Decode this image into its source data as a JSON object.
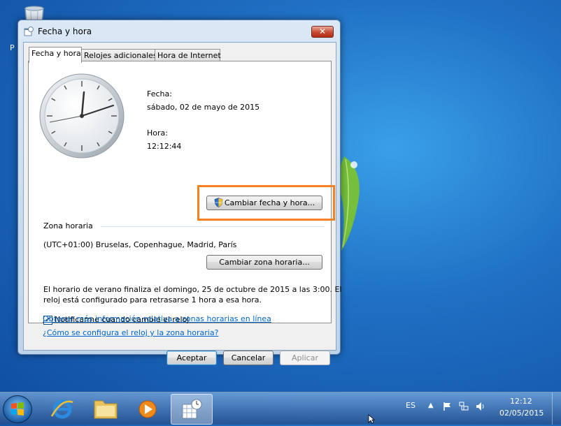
{
  "window": {
    "title": "Fecha y hora",
    "close_label": "✕"
  },
  "tabs": [
    {
      "label": "Fecha y hora",
      "active": true
    },
    {
      "label": "Relojes adicionales",
      "active": false
    },
    {
      "label": "Hora de Internet",
      "active": false
    }
  ],
  "date": {
    "label": "Fecha:",
    "value": "sábado, 02 de mayo de 2015"
  },
  "time": {
    "label": "Hora:",
    "value": "12:12:44"
  },
  "change_datetime_button": "Cambiar fecha y hora...",
  "timezone": {
    "section_label": "Zona horaria",
    "value": "(UTC+01:00) Bruselas, Copenhague, Madrid, París",
    "change_button": "Cambiar zona horaria..."
  },
  "dst_notice": {
    "line1": "El horario de verano finaliza el domingo, 25 de octubre de 2015 a las 3:00. El",
    "line2": "reloj está configurado para retrasarse 1 hora a esa hora."
  },
  "notify_checkbox": {
    "label": "Notificarme cuando cambie el reloj",
    "checked": true
  },
  "links": {
    "more_info": "Obtener más información relativa a zonas horarias en línea",
    "how_configured": "¿Cómo se configura el reloj y la zona horaria?"
  },
  "footer_buttons": {
    "ok": "Aceptar",
    "cancel": "Cancelar",
    "apply": "Aplicar"
  },
  "desktop": {
    "icon_label_fragment": "P"
  },
  "taskbar": {
    "language": "ES",
    "clock_time": "12:12",
    "clock_date": "02/05/2015"
  },
  "colors": {
    "highlight": "#f58220",
    "link": "#0066cc"
  }
}
